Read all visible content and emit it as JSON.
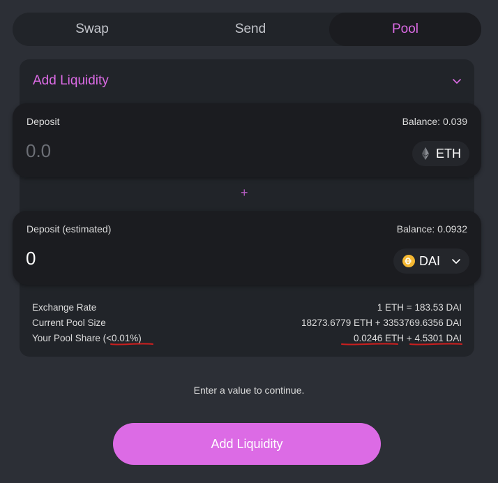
{
  "tabs": [
    {
      "label": "Swap"
    },
    {
      "label": "Send"
    },
    {
      "label": "Pool"
    }
  ],
  "panel": {
    "title": "Add Liquidity"
  },
  "deposit": {
    "label": "Deposit",
    "balance": "Balance: 0.039",
    "placeholder": "0.0",
    "token": "ETH",
    "token_icon": "ethereum-icon"
  },
  "plus_symbol": "+",
  "deposit_estimated": {
    "label": "Deposit (estimated)",
    "balance": "Balance: 0.0932",
    "value": "0",
    "token": "DAI",
    "token_icon": "dai-icon"
  },
  "info": {
    "exchange_rate_label": "Exchange Rate",
    "exchange_rate_value": "1 ETH = 183.53 DAI",
    "pool_size_label": "Current Pool Size",
    "pool_size_value": "18273.6779 ETH + 3353769.6356 DAI",
    "pool_share_label": "Your Pool Share",
    "pool_share_percent": "(<0.01%)",
    "pool_share_eth": "0.0246 ETH",
    "pool_share_plus": "+",
    "pool_share_dai": "4.5301 DAI"
  },
  "message": "Enter a value to continue.",
  "cta_label": "Add Liquidity",
  "colors": {
    "accent": "#dc6be5",
    "background": "#2c2f36",
    "panel": "#212429",
    "card": "#1b1c20",
    "annotation": "#cc1f1f",
    "dai": "#f4b731"
  }
}
